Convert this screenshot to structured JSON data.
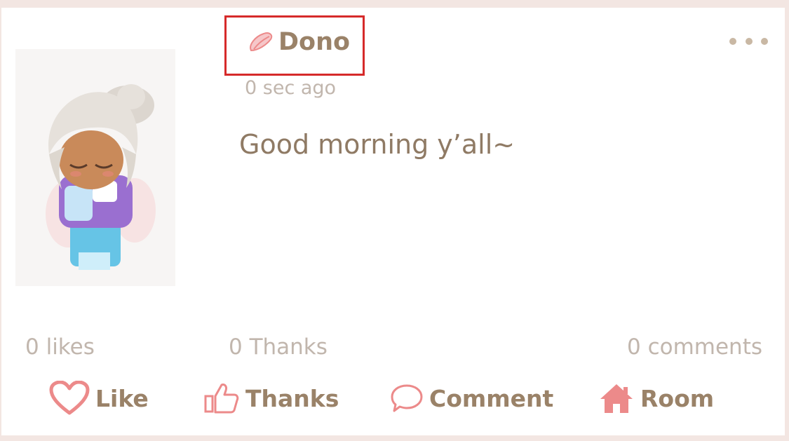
{
  "post": {
    "username": "Dono",
    "time": "0 sec ago",
    "text": "Good morning y’all~",
    "more_icon": "more-options-icon"
  },
  "stats": {
    "likes": "0 likes",
    "thanks": "0 Thanks",
    "comments": "0 comments"
  },
  "actions": {
    "like": "Like",
    "thanks": "Thanks",
    "comment": "Comment",
    "room": "Room"
  },
  "colors": {
    "brown_text": "#9a8268",
    "muted_text": "#c1b6ad",
    "icon_pink": "#ec8a8a",
    "highlight_border": "#d62a2a"
  }
}
